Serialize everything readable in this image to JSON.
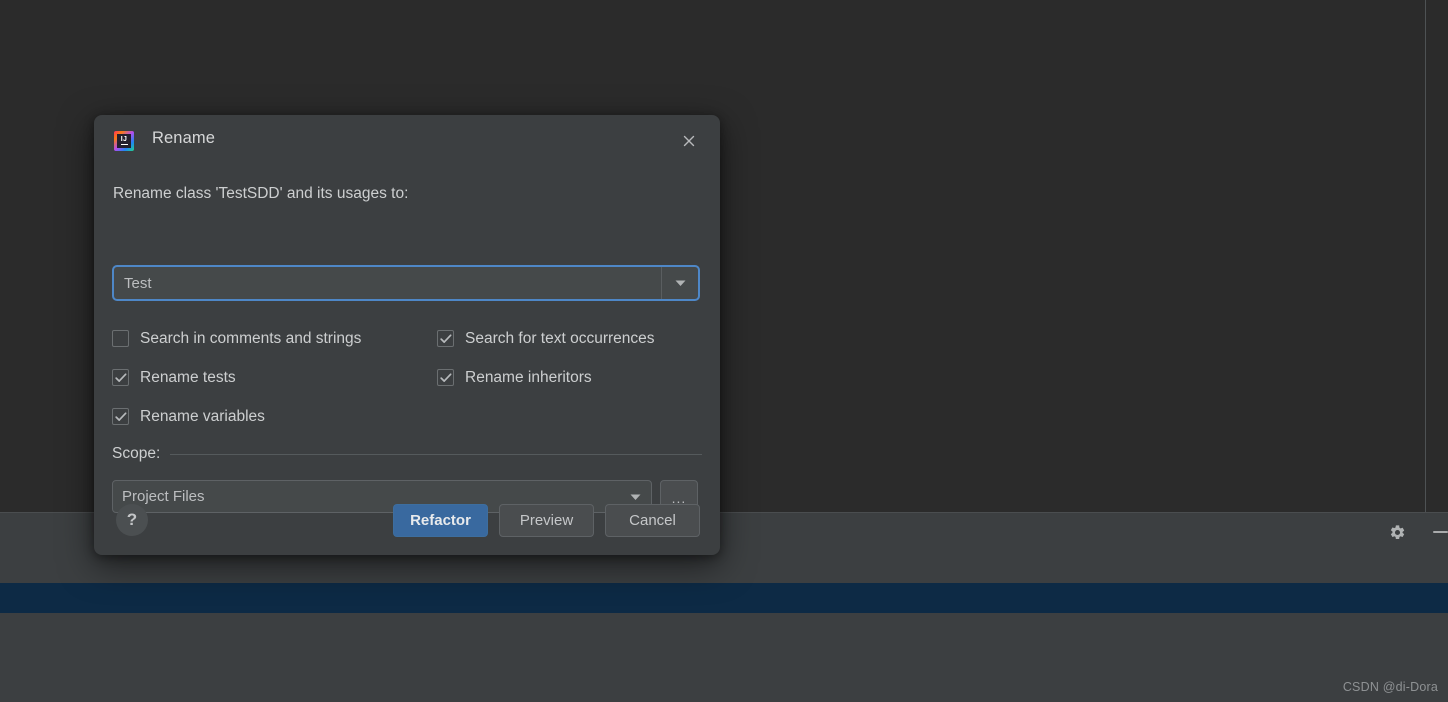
{
  "ide": {
    "tool_window": {
      "gear_icon": "gear-icon",
      "minimize_icon": "minimize-icon"
    },
    "watermark": "CSDN @di-Dora"
  },
  "dialog": {
    "app_icon": "intellij-idea-logo",
    "app_icon_text": "IJ",
    "title": "Rename",
    "close_icon": "close-icon",
    "prompt": "Rename class 'TestSDD' and its usages to:",
    "name_field": {
      "value": "Test",
      "placeholder": "",
      "dropdown_icon": "chevron-down-icon"
    },
    "options": [
      [
        {
          "label": "Search in comments and strings",
          "checked": false,
          "name": "search-in-comments-and-strings"
        },
        {
          "label": "Search for text occurrences",
          "checked": true,
          "name": "search-for-text-occurrences"
        }
      ],
      [
        {
          "label": "Rename tests",
          "checked": true,
          "name": "rename-tests"
        },
        {
          "label": "Rename inheritors",
          "checked": true,
          "name": "rename-inheritors"
        }
      ],
      [
        {
          "label": "Rename variables",
          "checked": true,
          "name": "rename-variables"
        },
        {
          "label": "",
          "checked": false,
          "name": "empty-slot",
          "hidden": true
        }
      ]
    ],
    "scope": {
      "title": "Scope:",
      "selected": "Project Files",
      "dropdown_icon": "chevron-down-icon",
      "browse_label": "..."
    },
    "footer": {
      "help_label": "?",
      "buttons": [
        {
          "label": "Refactor",
          "primary": true,
          "name": "refactor-button"
        },
        {
          "label": "Preview",
          "primary": false,
          "name": "preview-button"
        },
        {
          "label": "Cancel",
          "primary": false,
          "name": "cancel-button"
        }
      ]
    }
  },
  "colors": {
    "dialog_bg": "#3c3f41",
    "editor_bg": "#2b2b2b",
    "accent_blue": "#4e87c7",
    "primary_button": "#39699f",
    "selected_row": "#0d2a45"
  }
}
